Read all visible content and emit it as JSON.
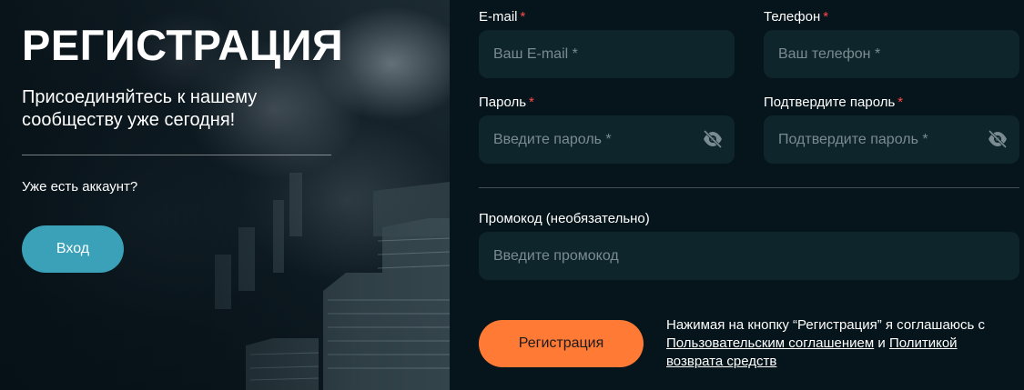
{
  "hero": {
    "title": "РЕГИСТРАЦИЯ",
    "subtitle": "Присоединяйтесь к нашему сообществу уже сегодня!",
    "account_prompt": "Уже есть аккаунт?",
    "login_label": "Вход"
  },
  "form": {
    "email": {
      "label": "E-mail",
      "required_mark": "*",
      "placeholder": "Ваш E-mail *",
      "value": ""
    },
    "phone": {
      "label": "Телефон",
      "required_mark": "*",
      "placeholder": "Ваш телефон *",
      "value": ""
    },
    "password": {
      "label": "Пароль",
      "required_mark": "*",
      "placeholder": "Введите пароль *",
      "value": "",
      "icon": "eye-off-icon"
    },
    "confirm": {
      "label": "Подтвердите пароль",
      "required_mark": "*",
      "placeholder": "Подтвердите пароль *",
      "value": "",
      "icon": "eye-off-icon"
    },
    "promo": {
      "label": "Промокод (необязательно)",
      "placeholder": "Введите промокод",
      "value": ""
    },
    "register_label": "Регистрация",
    "agreement": {
      "prefix": "Нажимая на кнопку “Регистрация” я соглашаюсь с",
      "link1": "Пользовательским соглашением",
      "conjunction": "и",
      "link2": "Политикой возврата средств"
    }
  },
  "colors": {
    "background": "#06151b",
    "input_bg": "#0f252c",
    "login_button": "#3aa1b8",
    "register_button": "#ff7a35",
    "required_mark": "#ff4b4b",
    "placeholder": "#7a8b91"
  }
}
